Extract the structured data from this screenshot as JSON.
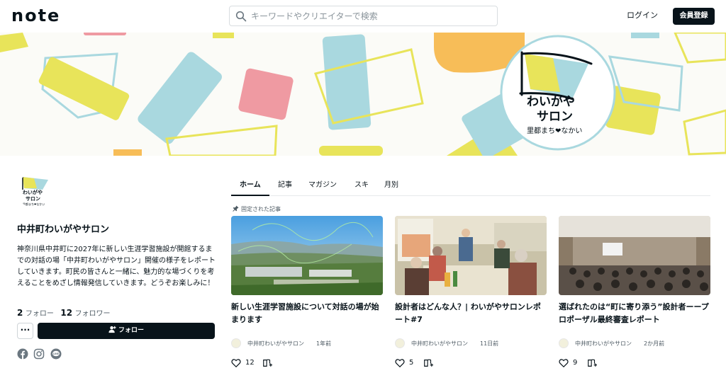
{
  "header": {
    "logo": "note",
    "search_placeholder": "キーワードやクリエイターで検索",
    "login": "ログイン",
    "signup": "会員登録"
  },
  "banner": {
    "logo_line1": "わいがや",
    "logo_line2": "サロン",
    "logo_sub": "里都まち❤なかい"
  },
  "profile": {
    "avatar_line1": "わいがや",
    "avatar_line2": "サロン",
    "avatar_sub": "里都まち❤なかい",
    "name": "中井町わいがやサロン",
    "bio": "神奈川県中井町に2027年に新しい生涯学習施設が開館するまでの対話の場「中井町わいがやサロン」開催の様子をレポートしていきます。町民の皆さんと一緒に、魅力的な場づくりを考えることをめざし情報発信していきます。どうぞお楽しみに！",
    "follow_count": "2",
    "follow_label": "フォロー",
    "follower_count": "12",
    "follower_label": "フォロワー",
    "more_label": "···",
    "follow_button": "フォロー",
    "social": [
      "facebook-icon",
      "instagram-icon",
      "line-icon"
    ]
  },
  "tabs": [
    "ホーム",
    "記事",
    "マガジン",
    "スキ",
    "月別"
  ],
  "pinned_label": "固定された記事",
  "cards": [
    {
      "title": "新しい生涯学習施設について対話の場が始まります",
      "author": "中井町わいがやサロン",
      "time": "1年前",
      "likes": "12"
    },
    {
      "title": "設計者はどんな人？| わいがやサロンレポート#7",
      "author": "中井町わいがやサロン",
      "time": "11日前",
      "likes": "5"
    },
    {
      "title": "選ばれたのは“町に寄り添う”設計者ーープロポーザル最終審査レポート",
      "author": "中井町わいがやサロン",
      "time": "2か月前",
      "likes": "9"
    }
  ],
  "colors": {
    "text": "#08131a",
    "yellow": "#e8e45a",
    "blue": "#a9d8df",
    "pink": "#ef9aa2",
    "orange": "#f7bd58"
  }
}
